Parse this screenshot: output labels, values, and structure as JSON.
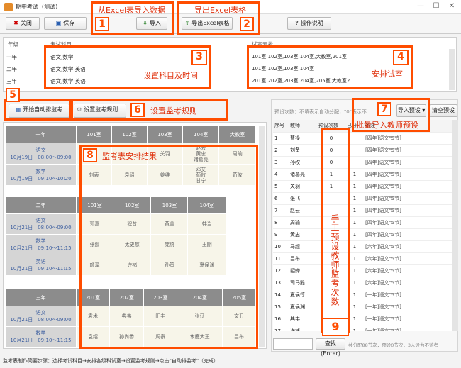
{
  "window": {
    "title": "期中考试（测试）"
  },
  "toolbar": {
    "close": "关闭",
    "save": "保存",
    "import": "导入",
    "export": "导出Excel表格",
    "help": "操作说明"
  },
  "table_top": {
    "headers": [
      "年级",
      "考试科目",
      "试室安排"
    ],
    "rows": [
      {
        "grade": "一年",
        "subjects": "语文,数学",
        "rooms": "101室,102室,103室,104室,大教室,201室"
      },
      {
        "grade": "二年",
        "subjects": "语文,数学,英语",
        "rooms": "101室,102室,103室,104室"
      },
      {
        "grade": "三年",
        "subjects": "语文,数学,英语",
        "rooms": "201室,202室,203室,204室,205室,大教室2"
      }
    ]
  },
  "buttons": {
    "auto_schedule": "开始自动排监考",
    "set_rules": "设置监考规则...",
    "import_preset": "导入预设",
    "clear_preset": "清空预设",
    "search": "查找(Enter)"
  },
  "right_header": {
    "note_prefix": "预设次数：",
    "note_text": "不填表示自动分配，\"0\"表示不"
  },
  "right_table": {
    "headers": [
      "序号",
      "教师",
      "预设次数",
      "已分",
      "备注"
    ],
    "rows": [
      {
        "no": "1",
        "teacher": "曹操",
        "preset": "0",
        "assigned": "",
        "note": "[四年]语文\"5节]"
      },
      {
        "no": "2",
        "teacher": "刘备",
        "preset": "0",
        "assigned": "",
        "note": "[四年]语文\"5节]"
      },
      {
        "no": "3",
        "teacher": "孙权",
        "preset": "0",
        "assigned": "",
        "note": "[四年]语文\"5节]"
      },
      {
        "no": "4",
        "teacher": "诸葛亮",
        "preset": "1",
        "assigned": "1",
        "note": "[四年]语文\"5节]"
      },
      {
        "no": "5",
        "teacher": "关羽",
        "preset": "1",
        "assigned": "1",
        "note": "[四年]语文\"5节]"
      },
      {
        "no": "6",
        "teacher": "张飞",
        "preset": "",
        "assigned": "1",
        "note": "[四年]语文\"5节]"
      },
      {
        "no": "7",
        "teacher": "赵云",
        "preset": "",
        "assigned": "1",
        "note": "[四年]语文\"5节]"
      },
      {
        "no": "8",
        "teacher": "周瑜",
        "preset": "",
        "assigned": "1",
        "note": "[四年]语文\"5节]"
      },
      {
        "no": "9",
        "teacher": "黄忠",
        "preset": "",
        "assigned": "1",
        "note": "[四年]语文\"5节]"
      },
      {
        "no": "10",
        "teacher": "马超",
        "preset": "",
        "assigned": "1",
        "note": "[六年]语文\"5节]"
      },
      {
        "no": "11",
        "teacher": "吕布",
        "preset": "",
        "assigned": "1",
        "note": "[六年]语文\"5节]"
      },
      {
        "no": "12",
        "teacher": "貂蝉",
        "preset": "",
        "assigned": "1",
        "note": "[六年]语文\"5节]"
      },
      {
        "no": "13",
        "teacher": "司马懿",
        "preset": "",
        "assigned": "1",
        "note": "[六年]语文\"5节]"
      },
      {
        "no": "14",
        "teacher": "夏侯惇",
        "preset": "",
        "assigned": "1",
        "note": "[一年]语文\"5节]"
      },
      {
        "no": "15",
        "teacher": "夏侯渊",
        "preset": "",
        "assigned": "1",
        "note": "[一年]语文\"5节]"
      },
      {
        "no": "16",
        "teacher": "典韦",
        "preset": "",
        "assigned": "1",
        "note": "[一年]语文\"5节]"
      },
      {
        "no": "17",
        "teacher": "许褚",
        "preset": "",
        "assigned": "1",
        "note": "[一年]语文\"5节]"
      }
    ]
  },
  "status": {
    "right": "共分配88节次，预设0节次，3人设为不监考",
    "bottom": "监考表制作简要步骤：选择考试科目→安排各级科试室→设置监考规则→点击\"自动排监考\"（完成）"
  },
  "sched": {
    "g1": {
      "grade": "一年",
      "rooms": [
        "101室",
        "102室",
        "103室",
        "104室",
        "大教室"
      ],
      "rows": [
        {
          "subject": "语文",
          "time": "10月19日　08:00～09:00",
          "cells": [
            "",
            "",
            "关羽",
            "赵云\n黄忠\n诸葛亮",
            "周瑜"
          ]
        },
        {
          "subject": "数学",
          "time": "10月19日　09:10～10:20",
          "cells": [
            "刘表",
            "袁绍",
            "姜维",
            "邓艾\n荀攸\n甘宁",
            "荀攸"
          ]
        }
      ]
    },
    "g2": {
      "grade": "二年",
      "rooms": [
        "101室",
        "102室",
        "103室",
        "104室"
      ],
      "rows": [
        {
          "subject": "语文",
          "time": "10月21日　08:00～09:00",
          "cells": [
            "郭嘉",
            "程昔",
            "黄盖",
            "韩当"
          ]
        },
        {
          "subject": "数学",
          "time": "10月21日　09:10～11:15",
          "cells": [
            "张郃",
            "太史慈",
            "庞统",
            "王朗"
          ]
        },
        {
          "subject": "英语",
          "time": "10月21日　09:10～11:15",
          "cells": [
            "颜泽",
            "许褚",
            "孙策",
            "夏侯渊"
          ]
        }
      ]
    },
    "g3": {
      "grade": "三年",
      "rooms": [
        "201室",
        "202室",
        "203室",
        "204室",
        "205室"
      ],
      "rows": [
        {
          "subject": "语文",
          "time": "10月21日　08:00～09:00",
          "cells": [
            "袁术",
            "典韦",
            "田丰",
            "张辽",
            "文丑"
          ]
        },
        {
          "subject": "数学",
          "time": "10月21日　09:10～11:15",
          "cells": [
            "袁绍",
            "孙尚香",
            "周泰",
            "木鹿大王",
            "吕布"
          ]
        }
      ]
    }
  },
  "annotations": {
    "a1": "从Excel表导入数据",
    "a2": "导出Excel表格",
    "a3": "设置科目及时间",
    "a4": "安排试室",
    "a6": "设置监考规则",
    "a7": "批量导入教师预设",
    "a8": "监考表安排结果",
    "a9": "手工预设教师监考次数",
    "n1": "1",
    "n2": "2",
    "n3": "3",
    "n4": "4",
    "n5": "5",
    "n6": "6",
    "n7": "7",
    "n8": "8",
    "n9": "9"
  }
}
